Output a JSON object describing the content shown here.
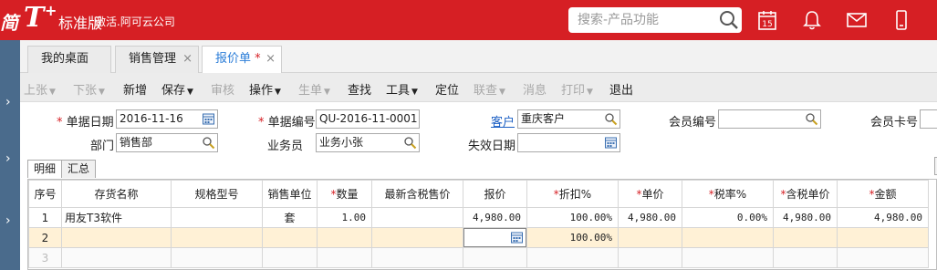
{
  "header": {
    "logo_left": "简",
    "logo_t": "T",
    "logo_plus": "+",
    "edition": "标准版",
    "company": "激活.阿可云公司",
    "search_placeholder": "搜索-产品功能",
    "calendar_day": "15",
    "brand_color": "#d61f24"
  },
  "tabs": [
    {
      "label": "我的桌面"
    },
    {
      "label": "销售管理",
      "close": "×"
    },
    {
      "label": "报价单",
      "modified": "*",
      "close": "×"
    }
  ],
  "toolbar": {
    "prev": "上张",
    "next": "下张",
    "new": "新增",
    "save": "保存",
    "audit": "审核",
    "operate": "操作",
    "generate": "生单",
    "find": "查找",
    "tools": "工具",
    "locate": "定位",
    "linked": "联查",
    "message": "消息",
    "print": "打印",
    "exit": "退出"
  },
  "form": {
    "doc_date_label": "单据日期",
    "doc_date": "2016-11-16",
    "doc_no_label": "单据编号",
    "doc_no": "QU-2016-11-0001",
    "customer_label": "客户",
    "customer": "重庆客户",
    "member_no_label": "会员编号",
    "member_no": "",
    "member_card_label": "会员卡号",
    "dept_label": "部门",
    "dept": "销售部",
    "salesman_label": "业务员",
    "salesman": "业务小张",
    "expire_label": "失效日期",
    "expire": ""
  },
  "subtabs": [
    "明细",
    "汇总"
  ],
  "grid": {
    "headers": [
      "序号",
      "存货名称",
      "规格型号",
      "销售单位",
      "数量",
      "最新含税售价",
      "报价",
      "折扣%",
      "单价",
      "税率%",
      "含税单价",
      "金额"
    ],
    "required_marker": "*",
    "rows": [
      {
        "no": "1",
        "name": "用友T3软件",
        "spec": "",
        "unit": "套",
        "qty": "1.00",
        "latest": "",
        "quote": "4,980.00",
        "discount": "100.00%",
        "price": "4,980.00",
        "tax": "0.00%",
        "taxprice": "4,980.00",
        "amount": "4,980.00"
      },
      {
        "no": "2",
        "name": "",
        "spec": "",
        "unit": "",
        "qty": "",
        "latest": "",
        "quote": "",
        "discount": "100.00%",
        "price": "",
        "tax": "",
        "taxprice": "",
        "amount": ""
      },
      {
        "no": "3",
        "name": "",
        "spec": "",
        "unit": "",
        "qty": "",
        "latest": "",
        "quote": "",
        "discount": "",
        "price": "",
        "tax": "",
        "taxprice": "",
        "amount": ""
      }
    ]
  }
}
